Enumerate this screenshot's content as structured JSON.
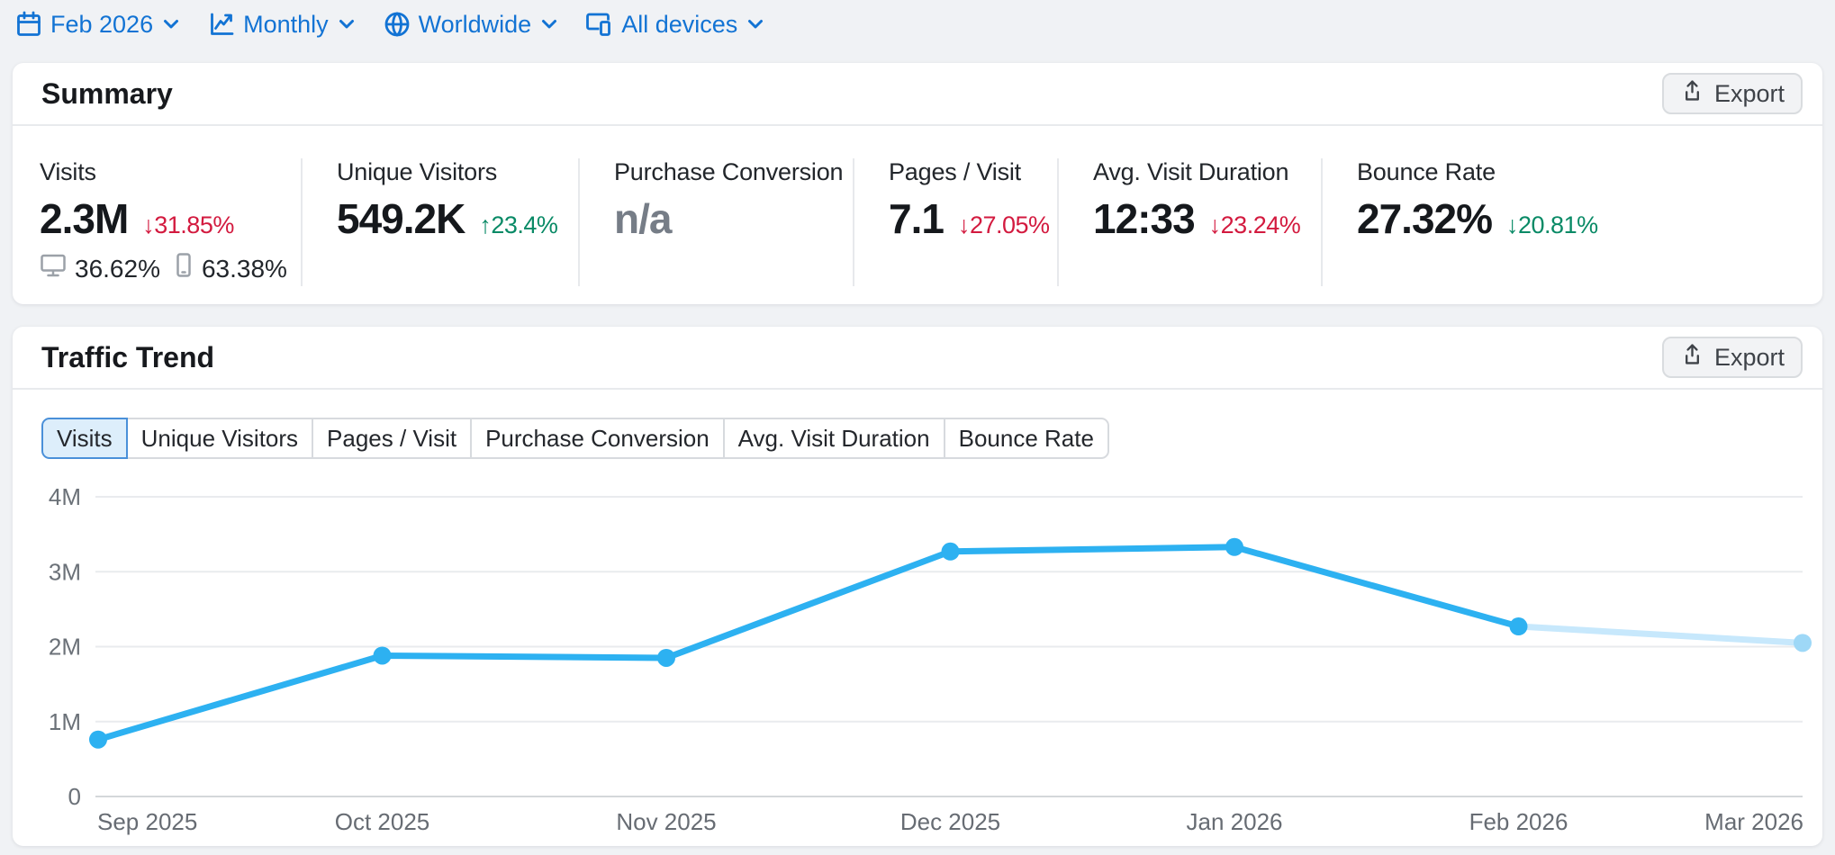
{
  "filters": [
    {
      "label": "Feb 2026",
      "icon": "calendar-icon"
    },
    {
      "label": "Monthly",
      "icon": "line-chart-icon"
    },
    {
      "label": "Worldwide",
      "icon": "globe-icon"
    },
    {
      "label": "All devices",
      "icon": "devices-icon"
    }
  ],
  "summary": {
    "title": "Summary",
    "export_label": "Export",
    "metrics": [
      {
        "label": "Visits",
        "value": "2.3M",
        "delta": "↓31.85%",
        "trend": "negative",
        "devices": {
          "desktop_share": "36.62%",
          "mobile_share": "63.38%"
        }
      },
      {
        "label": "Unique Visitors",
        "value": "549.2K",
        "delta": "↑23.4%",
        "trend": "positive"
      },
      {
        "label": "Purchase Conversion",
        "value": "n/a",
        "muted": true
      },
      {
        "label": "Pages / Visit",
        "value": "7.1",
        "delta": "↓27.05%",
        "trend": "negative"
      },
      {
        "label": "Avg. Visit Duration",
        "value": "12:33",
        "delta": "↓23.24%",
        "trend": "negative"
      },
      {
        "label": "Bounce Rate",
        "value": "27.32%",
        "delta": "↓20.81%",
        "trend": "positive"
      }
    ]
  },
  "trend": {
    "title": "Traffic Trend",
    "export_label": "Export",
    "tabs": [
      {
        "label": "Visits",
        "selected": true
      },
      {
        "label": "Unique Visitors",
        "selected": false
      },
      {
        "label": "Pages / Visit",
        "selected": false
      },
      {
        "label": "Purchase Conversion",
        "selected": false
      },
      {
        "label": "Avg. Visit Duration",
        "selected": false
      },
      {
        "label": "Bounce Rate",
        "selected": false
      }
    ]
  },
  "chart_data": {
    "type": "line",
    "title": "Traffic Trend — Visits",
    "x": [
      "Sep 2025",
      "Oct 2025",
      "Nov 2025",
      "Dec 2025",
      "Jan 2026",
      "Feb 2026",
      "Mar 2026"
    ],
    "series": [
      {
        "name": "Visits",
        "values": [
          760000,
          1880000,
          1850000,
          3270000,
          3330000,
          2270000,
          2050000
        ]
      }
    ],
    "ylim": [
      0,
      4000000
    ],
    "yticks": [
      {
        "value": 0,
        "label": "0"
      },
      {
        "value": 1000000,
        "label": "1M"
      },
      {
        "value": 2000000,
        "label": "2M"
      },
      {
        "value": 3000000,
        "label": "3M"
      },
      {
        "value": 4000000,
        "label": "4M"
      }
    ],
    "grid": "horizontal",
    "legend": "none",
    "line_color": "#2db1f1",
    "estimated_segment_color": "#c7e8fc",
    "estimated_point_color": "#9ed8f7",
    "estimated_from_index": 5
  },
  "colors": {
    "accent_blue": "#1273d4",
    "negative": "#d31a3f",
    "positive": "#098a66",
    "page_bg": "#f0f2f5"
  }
}
